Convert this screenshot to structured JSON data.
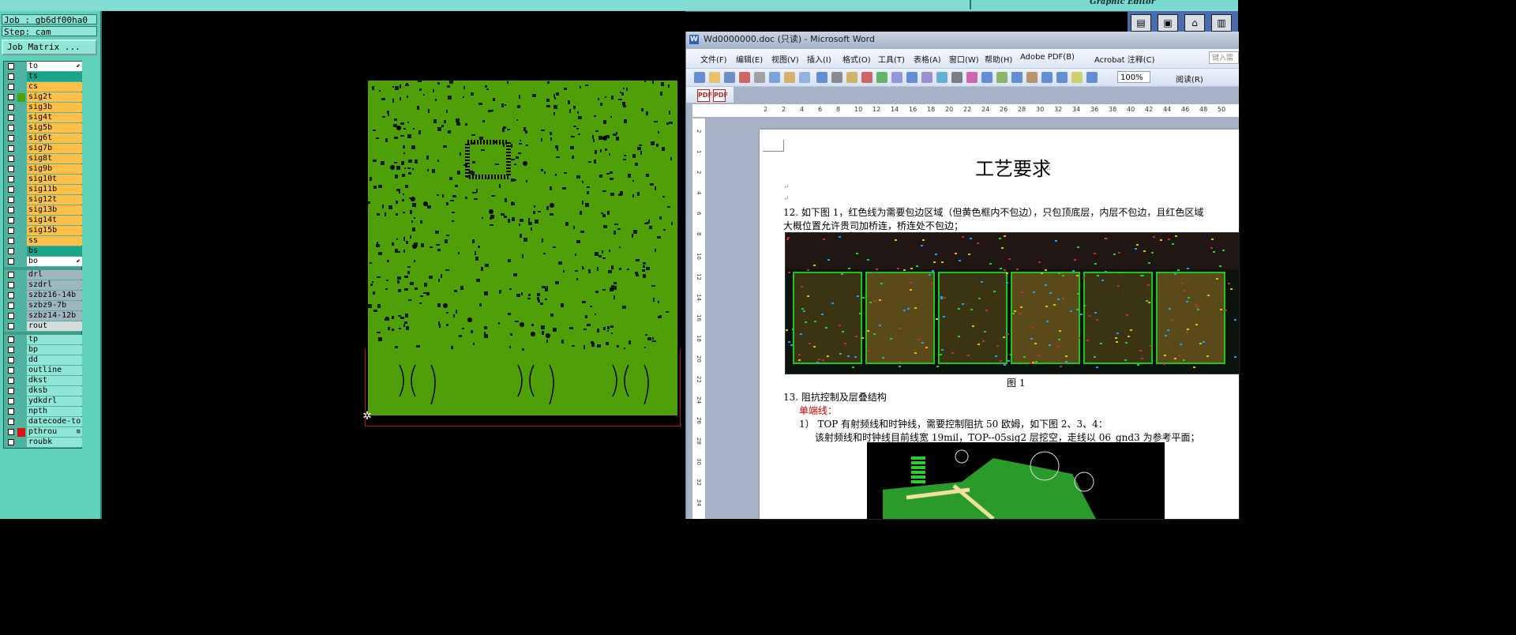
{
  "top_bar": {
    "brand_subtitle": "Graphic Editor"
  },
  "left_panel": {
    "job": "Job : gb6df00ha0",
    "step": "Step: cam",
    "job_matrix_button": "Job Matrix ...",
    "layers": [
      {
        "name": "to",
        "style": "white",
        "swatch": "",
        "marker": "⬋"
      },
      {
        "name": "ts",
        "style": "teal",
        "swatch": ""
      },
      {
        "name": "cs",
        "style": "orange",
        "swatch": ""
      },
      {
        "name": "sig2t",
        "style": "orange",
        "swatch": "#4fa008"
      },
      {
        "name": "sig3b",
        "style": "orange",
        "swatch": ""
      },
      {
        "name": "sig4t",
        "style": "orange",
        "swatch": ""
      },
      {
        "name": "sig5b",
        "style": "orange",
        "swatch": ""
      },
      {
        "name": "sig6t",
        "style": "orange",
        "swatch": ""
      },
      {
        "name": "sig7b",
        "style": "orange",
        "swatch": ""
      },
      {
        "name": "sig8t",
        "style": "orange",
        "swatch": ""
      },
      {
        "name": "sig9b",
        "style": "orange",
        "swatch": ""
      },
      {
        "name": "sig10t",
        "style": "orange",
        "swatch": ""
      },
      {
        "name": "sig11b",
        "style": "orange",
        "swatch": ""
      },
      {
        "name": "sig12t",
        "style": "orange",
        "swatch": ""
      },
      {
        "name": "sig13b",
        "style": "orange",
        "swatch": ""
      },
      {
        "name": "sig14t",
        "style": "orange",
        "swatch": ""
      },
      {
        "name": "sig15b",
        "style": "orange",
        "swatch": ""
      },
      {
        "name": "ss",
        "style": "orange",
        "swatch": ""
      },
      {
        "name": "bs",
        "style": "teal",
        "swatch": ""
      },
      {
        "name": "bo",
        "style": "white",
        "swatch": "",
        "marker": "⬋"
      }
    ],
    "drill_layers": [
      {
        "name": "drl",
        "style": "gray"
      },
      {
        "name": "szdrl",
        "style": "gray"
      },
      {
        "name": "szbz16-14b",
        "style": "gray"
      },
      {
        "name": "szbz9-7b",
        "style": "gray"
      },
      {
        "name": "szbz14-12b",
        "style": "gray"
      },
      {
        "name": "rout",
        "style": "lgray"
      }
    ],
    "doc_layers": [
      {
        "name": "tp",
        "style": "cyan"
      },
      {
        "name": "bp",
        "style": "cyan"
      },
      {
        "name": "dd",
        "style": "cyan"
      },
      {
        "name": "outline",
        "style": "cyan"
      },
      {
        "name": "dkst",
        "style": "cyan"
      },
      {
        "name": "dksb",
        "style": "cyan"
      },
      {
        "name": "ydkdrl",
        "style": "cyan"
      },
      {
        "name": "npth",
        "style": "cyan"
      },
      {
        "name": "datecode-to",
        "style": "cyan"
      },
      {
        "name": "pthrou",
        "style": "cyan",
        "swatch": "#e01010",
        "marker": "≡"
      },
      {
        "name": "roubk",
        "style": "cyan"
      }
    ]
  },
  "word": {
    "title": "Wd0000000.doc (只读) - Microsoft Word",
    "menu": [
      "文件(F)",
      "编辑(E)",
      "视图(V)",
      "插入(I)",
      "格式(O)",
      "工具(T)",
      "表格(A)",
      "窗口(W)",
      "帮助(H)",
      "Adobe PDF(B)",
      "Acrobat 注释(C)"
    ],
    "help_placeholder": "键入需",
    "zoom": "100%",
    "read_mode": "阅读(R)",
    "ruler": [
      "2",
      "2",
      "4",
      "6",
      "8",
      "10",
      "12",
      "14",
      "16",
      "18",
      "20",
      "22",
      "24",
      "26",
      "28",
      "30",
      "32",
      "34",
      "36",
      "38",
      "40",
      "42",
      "44",
      "46",
      "48",
      "50"
    ],
    "vruler": [
      "2",
      "1",
      "2",
      "4",
      "6",
      "8",
      "10",
      "12",
      "14",
      "16",
      "18",
      "20",
      "22",
      "24",
      "26",
      "28",
      "30",
      "32",
      "34"
    ],
    "doc": {
      "heading": "工艺要求",
      "p12_line1": "12. 如下图 1，红色线为需要包边区域（但黄色框内不包边），只包顶底层，内层不包边，且红色区域",
      "p12_line2": "大概位置允许贵司加桥连，桥连处不包边；",
      "figure1_caption": "图 1",
      "p13": "13. 阻抗控制及层叠结构",
      "single_ended": "单端线：",
      "item1": "1）  TOP 有射频线和时钟线，需要控制阻抗 50 欧姆，如下图 2、3、4：",
      "item1b": "该射频线和时钟线目前线宽 19mil，TOP--05sig2 层挖空，走线以 06_gnd3 为参考平面；"
    }
  },
  "colors": {
    "board": "#4fa008",
    "panel": "#5fd1b8",
    "orange_layer": "#ffc04a"
  }
}
